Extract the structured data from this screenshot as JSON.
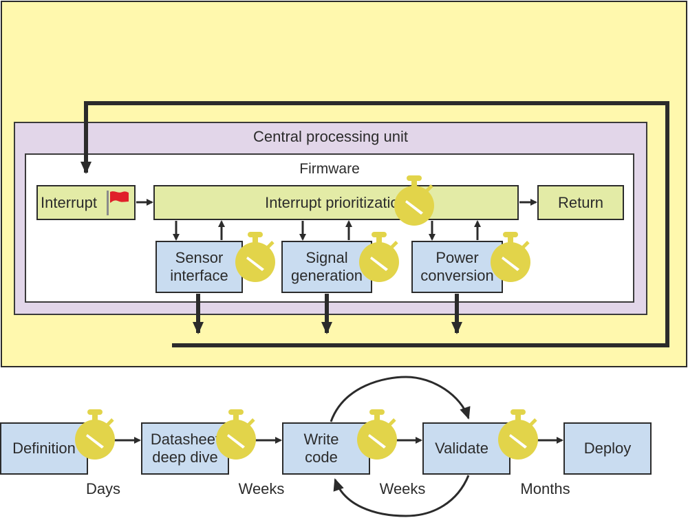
{
  "top_diagram": {
    "outer_container_label": "",
    "cpu_label": "Central processing unit",
    "firmware_label": "Firmware",
    "blocks": {
      "interrupt": "Interrupt",
      "prioritization": "Interrupt prioritization",
      "return": "Return",
      "sensor": [
        "Sensor",
        "interface"
      ],
      "signal": [
        "Signal",
        "generation"
      ],
      "power": [
        "Power",
        "conversion"
      ]
    },
    "icons": {
      "interrupt_flag": "flag-icon",
      "timer": "stopwatch-icon"
    }
  },
  "bottom_flow": {
    "steps": [
      {
        "label": [
          "Definition"
        ],
        "duration": "Days"
      },
      {
        "label": [
          "Datasheet",
          "deep dive"
        ],
        "duration": "Weeks"
      },
      {
        "label": [
          "Write",
          "code"
        ],
        "duration": "Weeks"
      },
      {
        "label": [
          "Validate"
        ],
        "duration": "Months"
      },
      {
        "label": [
          "Deploy"
        ],
        "duration": ""
      }
    ],
    "loop": "Write code ↔ Validate iteration"
  },
  "colors": {
    "outer": "#fff8ad",
    "cpu": "#e2d6e9",
    "firmware": "#ffffff",
    "green_block": "#e3eba6",
    "blue_block": "#c9dcf0",
    "timer": "#e2d44a",
    "flag": "#e0202a",
    "line": "#2b2b2b"
  }
}
